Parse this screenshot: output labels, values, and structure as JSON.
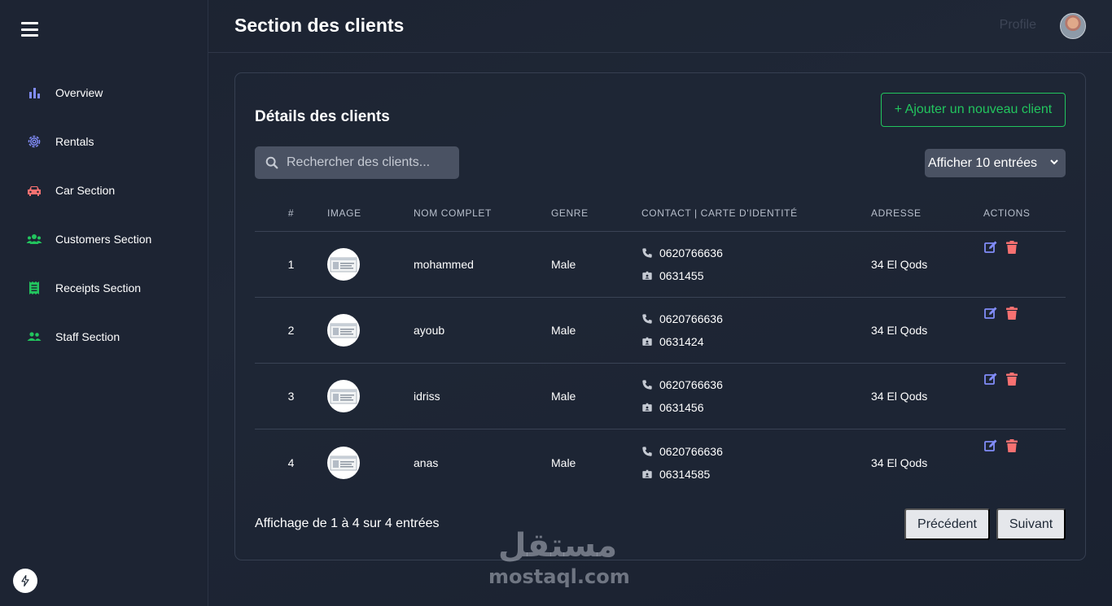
{
  "header": {
    "title": "Section des clients",
    "profile_label": "Profile"
  },
  "sidebar": {
    "items": [
      {
        "label": "Overview",
        "icon": "bar-chart-icon",
        "color": "#818cf8"
      },
      {
        "label": "Rentals",
        "icon": "gear-icon",
        "color": "#818cf8"
      },
      {
        "label": "Car Section",
        "icon": "car-icon",
        "color": "#f87171"
      },
      {
        "label": "Customers Section",
        "icon": "users-icon",
        "color": "#22c55e"
      },
      {
        "label": "Receipts Section",
        "icon": "receipt-icon",
        "color": "#22c55e"
      },
      {
        "label": "Staff Section",
        "icon": "user-group-icon",
        "color": "#22c55e"
      }
    ]
  },
  "card": {
    "title": "Détails des clients",
    "add_button": "+ Ajouter un nouveau client",
    "search_placeholder": "Rechercher des clients...",
    "entries_select": "Afficher 10 entrées",
    "accent_color": "#22c55e"
  },
  "table": {
    "headers": [
      "#",
      "IMAGE",
      "NOM COMPLET",
      "GENRE",
      "CONTACT | CARTE D'IDENTITÉ",
      "ADRESSE",
      "ACTIONS"
    ],
    "rows": [
      {
        "num": "1",
        "name": "mohammed",
        "genre": "Male",
        "phone": "0620766636",
        "id_card": "0631455",
        "address": "34 El Qods"
      },
      {
        "num": "2",
        "name": "ayoub",
        "genre": "Male",
        "phone": "0620766636",
        "id_card": "0631424",
        "address": "34 El Qods"
      },
      {
        "num": "3",
        "name": "idriss",
        "genre": "Male",
        "phone": "0620766636",
        "id_card": "0631456",
        "address": "34 El Qods"
      },
      {
        "num": "4",
        "name": "anas",
        "genre": "Male",
        "phone": "0620766636",
        "id_card": "06314585",
        "address": "34 El Qods"
      }
    ]
  },
  "pagination": {
    "info": "Affichage de 1 à 4 sur 4 entrées",
    "prev": "Précédent",
    "next": "Suivant"
  },
  "watermark": {
    "arabic": "مستقل",
    "latin": "mostaql.com"
  }
}
